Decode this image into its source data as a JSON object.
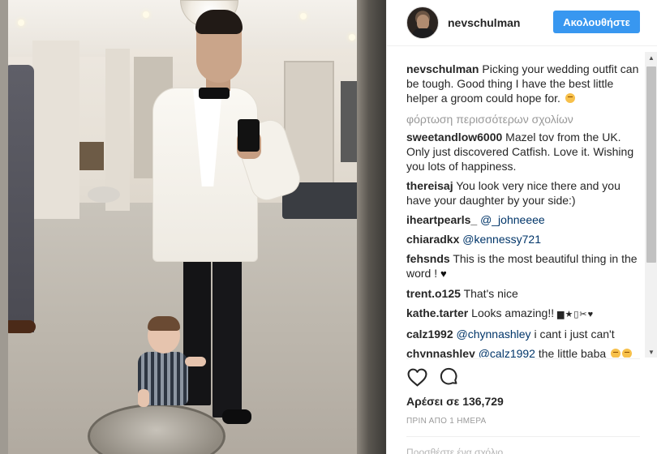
{
  "post": {
    "username": "nevschulman",
    "follow_label": "Ακολουθήστε",
    "caption_user": "nevschulman",
    "caption_text": "Picking your wedding outfit can be tough. Good thing I have the best little helper a groom could hope for.",
    "load_more": "φόρτωση περισσότερων σχολίων",
    "likes": "Αρέσει σε 136,729",
    "timestamp": "ΠΡΙΝ ΑΠΟ 1 ΗΜΕΡΑ",
    "add_comment_placeholder": "Προσθέστε ένα σχόλιο..."
  },
  "comments": [
    {
      "user": "sweetandlow6000",
      "text": "Mazel tov from the UK. Only just discovered Catfish. Love it. Wishing you lots of happiness."
    },
    {
      "user": "thereisaj",
      "text": "You look very nice there and you have your daughter by your side:)"
    },
    {
      "user": "iheartpearls_",
      "mention": "@_johneeee"
    },
    {
      "user": "chiaradkx",
      "mention": "@kennessy721"
    },
    {
      "user": "fehsnds",
      "text": "This is the most beautiful thing in the word !"
    },
    {
      "user": "trent.o125",
      "text": "That's nice"
    },
    {
      "user": "kathe.tarter",
      "text": "Looks amazing!!"
    },
    {
      "user": "calz1992",
      "mention": "@chynnashley",
      "text": "i cant i just can't"
    },
    {
      "user": "chynnashley",
      "mention": "@calz1992",
      "text": "the little baba"
    }
  ],
  "icons": {
    "like": "heart-outline-icon",
    "comment": "speech-bubble-icon",
    "scroll_up": "scroll-up-arrow-icon",
    "scroll_down": "scroll-down-arrow-icon"
  },
  "colors": {
    "follow_button": "#3897f0",
    "mention": "#003569",
    "muted": "#999999",
    "text": "#262626"
  }
}
